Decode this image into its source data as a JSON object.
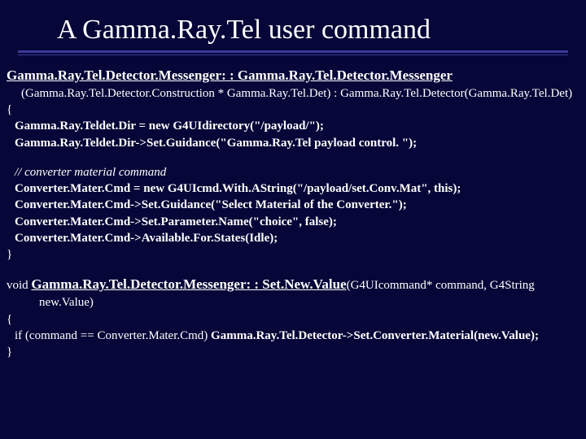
{
  "title": "A Gamma.Ray.Tel user command",
  "sig1": "Gamma.Ray.Tel.Detector.Messenger: : Gamma.Ray.Tel.Detector.Messenger",
  "sigargs": "(Gamma.Ray.Tel.Detector.Construction * Gamma.Ray.Tel.Det) : Gamma.Ray.Tel.Detector(Gamma.Ray.Tel.Det)",
  "brace_open": "{",
  "body1": "Gamma.Ray.Teldet.Dir = new G4UIdirectory(\"/payload/\");",
  "body2": "Gamma.Ray.Teldet.Dir->Set.Guidance(\"Gamma.Ray.Tel payload control. \");",
  "comment": "// converter material command",
  "body3": "Converter.Mater.Cmd = new G4UIcmd.With.AString(\"/payload/set.Conv.Mat\", this);",
  "body4": "Converter.Mater.Cmd->Set.Guidance(\"Select Material of the Converter.\");",
  "body5": "Converter.Mater.Cmd->Set.Parameter.Name(\"choice\", false);",
  "body6": "Converter.Mater.Cmd->Available.For.States(Idle);",
  "brace_close": "}",
  "sig2_pre": "void ",
  "sig2_bold": "Gamma.Ray.Tel.Detector.Messenger: : Set.New.Value",
  "sig2_post": "(G4UIcommand* command, G4String",
  "sig2_line2": "new.Value)",
  "body7_pre": "if (command == Converter.Mater.Cmd) ",
  "body7_bold": "Gamma.Ray.Tel.Detector->Set.Converter.Material(new.Value);"
}
